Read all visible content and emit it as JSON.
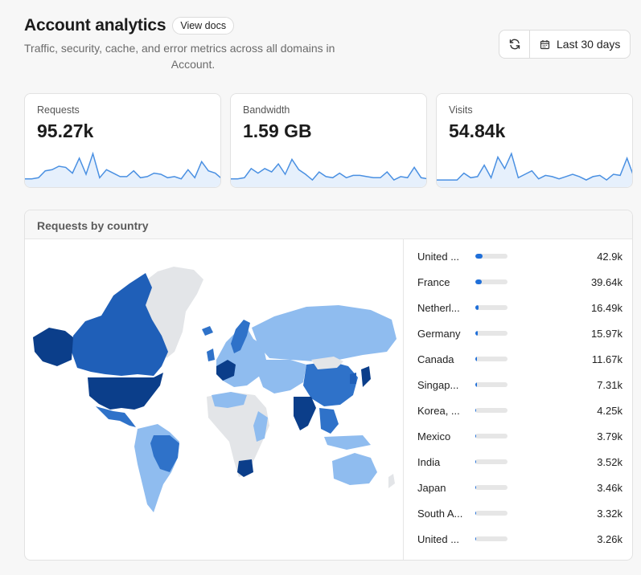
{
  "header": {
    "title": "Account analytics",
    "docs_label": "View docs",
    "subtitle_line1": "Traffic, security, cache, and error metrics across all domains in",
    "subtitle_line2": "Account."
  },
  "toolbar": {
    "refresh_icon": "refresh-icon",
    "calendar_icon": "calendar-icon",
    "range_label": "Last 30 days"
  },
  "cards": [
    {
      "label": "Requests",
      "value": "95.27k",
      "sparkline": [
        3,
        3,
        4,
        10,
        11,
        14,
        13,
        8,
        21,
        7,
        25,
        4,
        11,
        8,
        5,
        5,
        10,
        4,
        5,
        8,
        7,
        4,
        5,
        3,
        11,
        4,
        18,
        10,
        8,
        3
      ]
    },
    {
      "label": "Bandwidth",
      "value": "1.59 GB",
      "sparkline": [
        3,
        3,
        4,
        12,
        8,
        12,
        9,
        16,
        7,
        20,
        11,
        7,
        2,
        9,
        5,
        4,
        8,
        4,
        6,
        6,
        5,
        4,
        4,
        9,
        2,
        5,
        4,
        13,
        4,
        3
      ]
    },
    {
      "label": "Visits",
      "value": "54.84k",
      "sparkline": [
        2,
        2,
        2,
        2,
        8,
        4,
        5,
        15,
        4,
        22,
        12,
        25,
        4,
        7,
        10,
        3,
        6,
        5,
        3,
        5,
        7,
        5,
        2,
        5,
        6,
        2,
        7,
        6,
        21,
        5
      ]
    }
  ],
  "panel": {
    "title": "Requests by country",
    "countries": [
      {
        "name": "United ...",
        "count": "42.9k",
        "share": 0.22
      },
      {
        "name": "France",
        "count": "39.64k",
        "share": 0.2
      },
      {
        "name": "Netherl...",
        "count": "16.49k",
        "share": 0.09
      },
      {
        "name": "Germany",
        "count": "15.97k",
        "share": 0.08
      },
      {
        "name": "Canada",
        "count": "11.67k",
        "share": 0.06
      },
      {
        "name": "Singap...",
        "count": "7.31k",
        "share": 0.04
      },
      {
        "name": "Korea, ...",
        "count": "4.25k",
        "share": 0.03
      },
      {
        "name": "Mexico",
        "count": "3.79k",
        "share": 0.02
      },
      {
        "name": "India",
        "count": "3.52k",
        "share": 0.02
      },
      {
        "name": "Japan",
        "count": "3.46k",
        "share": 0.02
      },
      {
        "name": "South A...",
        "count": "3.32k",
        "share": 0.02
      },
      {
        "name": "United ...",
        "count": "3.26k",
        "share": 0.02
      }
    ]
  },
  "colors": {
    "accent": "#1f6fd9",
    "spark_line": "#4a90e2",
    "spark_fill": "#e6f0fc",
    "map_dark": "#0b3e8a",
    "map_mid": "#2f72c9",
    "map_light": "#8fbcef",
    "map_none": "#e3e5e8"
  }
}
